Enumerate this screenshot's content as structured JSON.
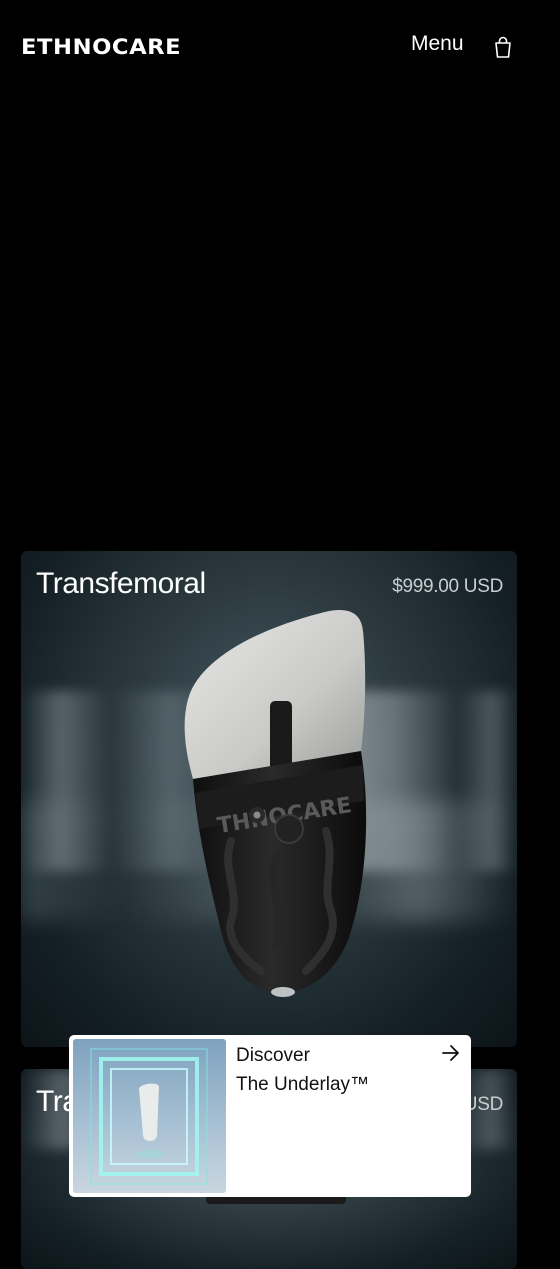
{
  "header": {
    "logo": "ETHNOCARE",
    "menu_label": "Menu",
    "cart_icon": "shopping-bag-icon"
  },
  "products": [
    {
      "title": "Transfemoral",
      "price": "$999.00 USD"
    },
    {
      "title": "Tra",
      "price": "USD"
    }
  ],
  "product_image_text": "THNOCARE",
  "promo": {
    "line1": "Discover",
    "line2": "The Underlay™",
    "arrow_icon": "arrow-right-icon"
  }
}
